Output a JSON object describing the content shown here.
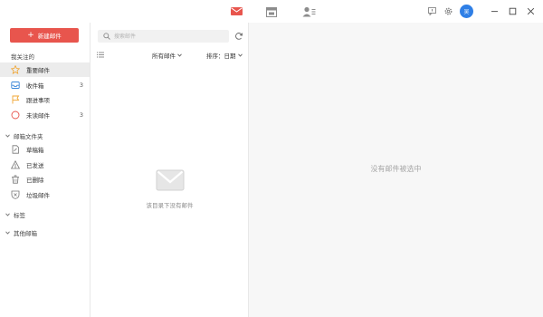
{
  "topbar": {
    "tabs": [
      {
        "icon": "mail-icon",
        "active": true
      },
      {
        "icon": "calendar-icon",
        "active": false
      },
      {
        "icon": "contacts-icon",
        "active": false
      }
    ],
    "avatar_text": "吴",
    "accent": "#e8554d"
  },
  "sidebar": {
    "new_mail_label": "新建邮件",
    "section_focus": "我关注的",
    "focus_items": [
      {
        "label": "重要邮件",
        "count": "",
        "icon": "star-icon"
      },
      {
        "label": "收件箱",
        "count": "3",
        "icon": "inbox-icon"
      },
      {
        "label": "跟进事项",
        "count": "",
        "icon": "flag-icon"
      },
      {
        "label": "未读邮件",
        "count": "3",
        "icon": "unread-circle-icon"
      }
    ],
    "group_folders": "邮箱文件夹",
    "folder_items": [
      {
        "label": "草稿箱",
        "icon": "draft-icon"
      },
      {
        "label": "已发送",
        "icon": "sent-icon"
      },
      {
        "label": "已删除",
        "icon": "trash-icon"
      },
      {
        "label": "垃圾邮件",
        "icon": "spam-icon"
      }
    ],
    "group_tags": "标签",
    "group_other": "其他邮箱"
  },
  "list": {
    "search_placeholder": "搜索邮件",
    "folder_filter": "所有邮件",
    "sort_label": "排序：日期",
    "empty_message": "该目录下没有邮件"
  },
  "reading": {
    "no_selection": "没有邮件被选中"
  }
}
